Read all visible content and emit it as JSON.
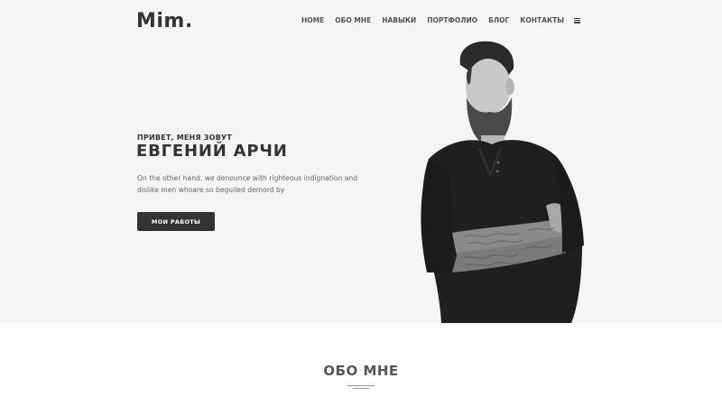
{
  "brand": {
    "logo": "Mim."
  },
  "nav": {
    "items": [
      "HOME",
      "ОБО МНЕ",
      "НАВЫКИ",
      "ПОРТФОЛИО",
      "БЛОГ",
      "КОНТАКТЫ"
    ],
    "menu_icon": "hamburger-icon"
  },
  "hero": {
    "greeting": "ПРИВЕТ, МЕНЯ ЗОВУТ",
    "name": "ЕВГЕНИЙ АРЧИ",
    "description": "On the other hand, we denounce with righteous indignation and dislike men whoare so beguiled demord by",
    "button_label": "МОИ РАБОТЫ",
    "background": "#f5f5f5"
  },
  "about": {
    "title": "ОБО МНЕ"
  },
  "colors": {
    "text_dark": "#333333",
    "text_muted": "#666666",
    "button_bg": "#333333"
  }
}
